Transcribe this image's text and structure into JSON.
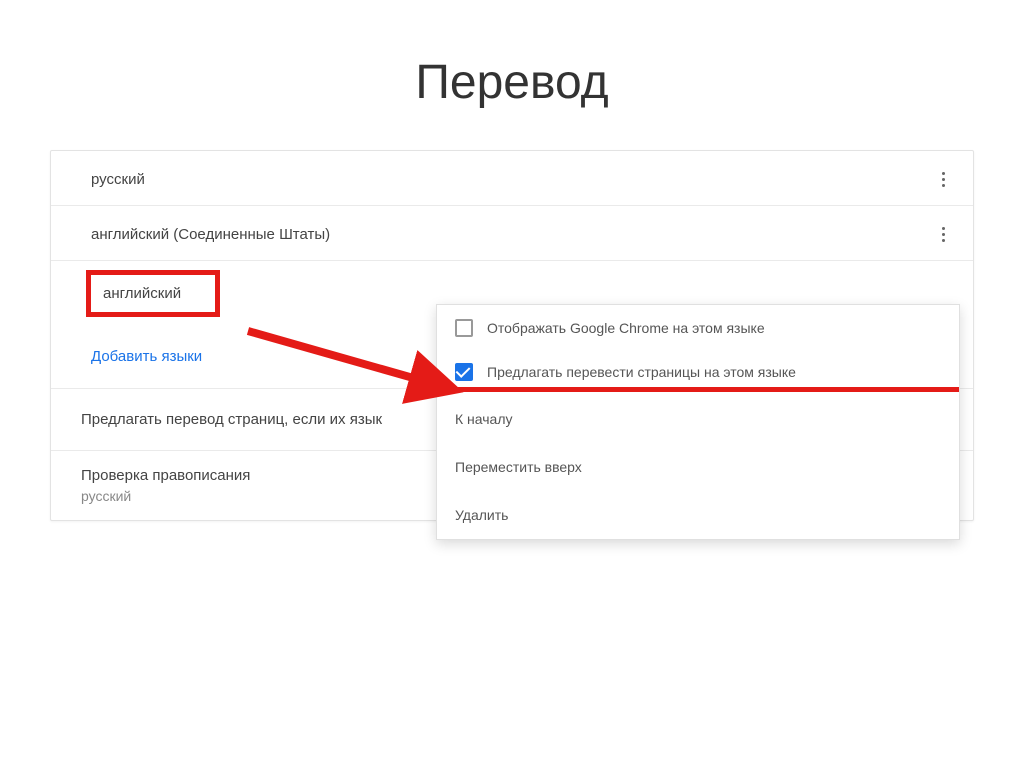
{
  "title": "Перевод",
  "languages": {
    "russian": "русский",
    "english_us": "английский (Соединенные Штаты)",
    "english": "английский"
  },
  "add_languages_link": "Добавить языки",
  "offer_translate_truncated": "Предлагать перевод страниц, если их язык",
  "spellcheck": {
    "title": "Проверка правописания",
    "subtitle": "русский"
  },
  "popup": {
    "option_display": "Отображать Google Chrome на этом языке",
    "option_translate": "Предлагать перевести страницы на этом языке",
    "action_top": "К началу",
    "action_up": "Переместить вверх",
    "action_delete": "Удалить"
  },
  "colors": {
    "highlight_red": "#e41b17",
    "link_blue": "#1a73e8"
  }
}
